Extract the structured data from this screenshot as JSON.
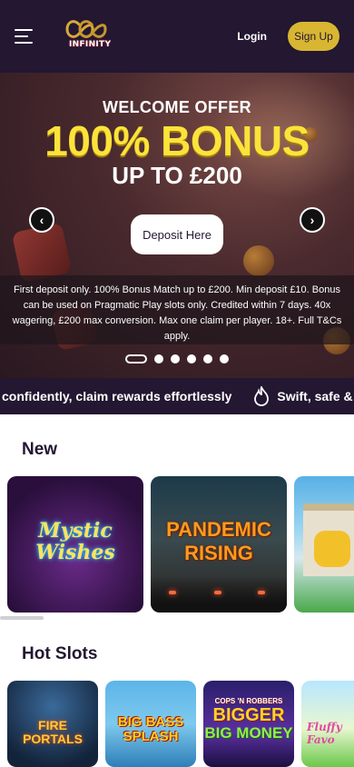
{
  "header": {
    "logo_text": "INFINITY",
    "login_label": "Login",
    "signup_label": "Sign Up",
    "colors": {
      "background": "#231731",
      "signup_bg": "#d9b632"
    }
  },
  "hero": {
    "line1": "WELCOME OFFER",
    "line2": "100% BONUS",
    "line3": "UP TO £200",
    "cta_label": "Deposit Here",
    "terms": "First deposit only. 100% Bonus Match up to £200. Min deposit £10. Bonus can be used on Pragmatic Play slots only. Credited within 7 days. 40x wagering, £200 max conversion. Max one claim per player. 18+. Full T&Cs apply.",
    "prev_icon": "chevron-left-icon",
    "next_icon": "chevron-right-icon",
    "slide_count": 6,
    "active_slide": 1
  },
  "ticker": {
    "text1": "confidently, claim rewards effortlessly",
    "icon": "flame-icon",
    "text2": "Swift, safe & s"
  },
  "sections": {
    "new": {
      "title": "New",
      "games": [
        "Mystic Wishes",
        "PANDEMIC RISING"
      ]
    },
    "hot_slots": {
      "title": "Hot Slots",
      "games": [
        "FIRE PORTALS",
        "BIG BASS SPLASH",
        "COPS 'N ROBBERS",
        "BIGGER",
        "BIG MONEY",
        "Fluffy Favo"
      ]
    }
  }
}
